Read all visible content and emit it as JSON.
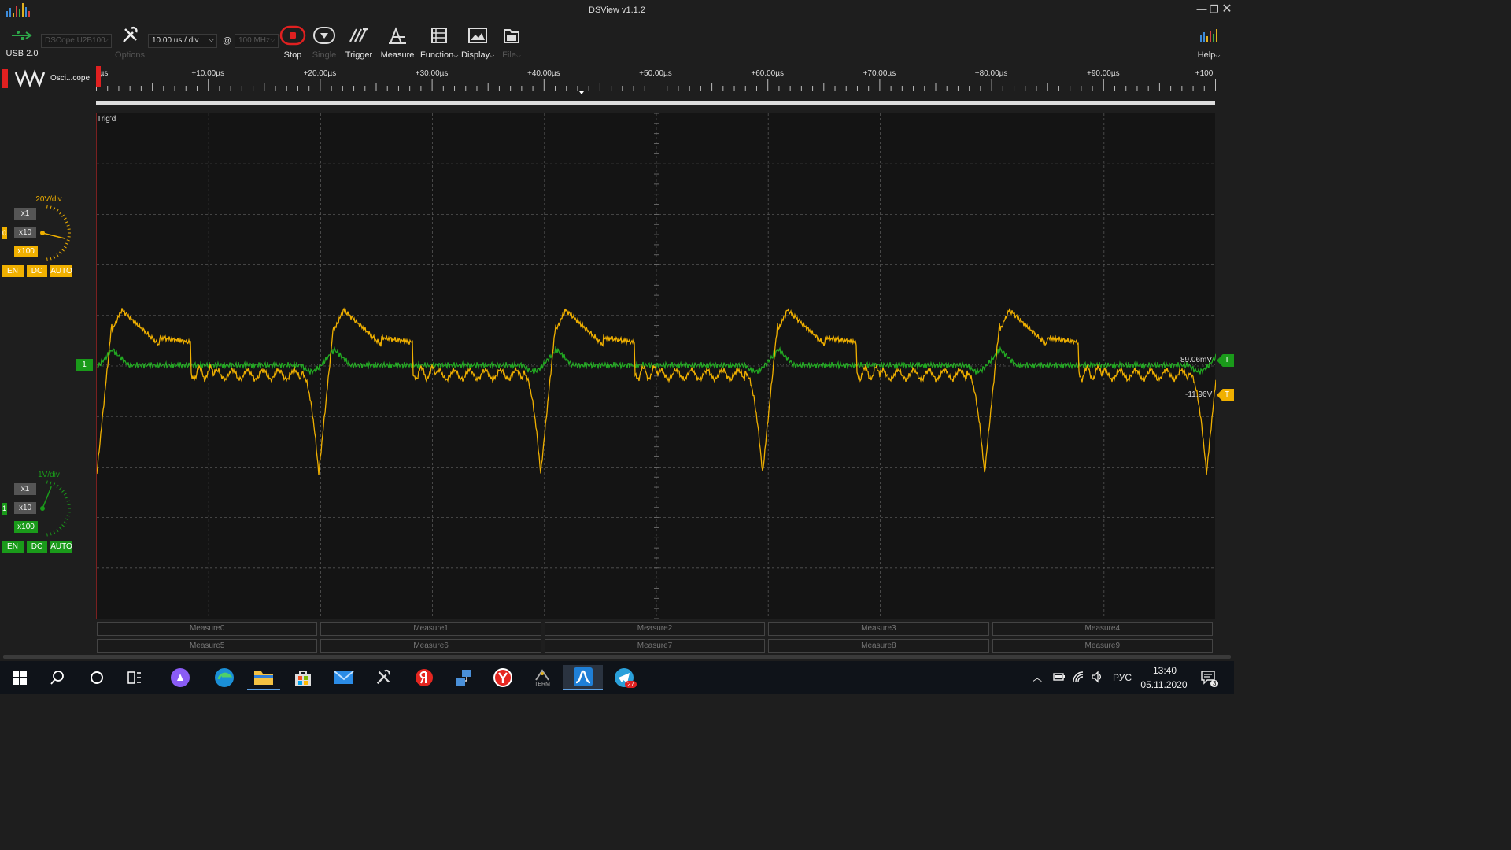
{
  "window": {
    "title": "DSView v1.1.2"
  },
  "toolbar": {
    "usb_label": "USB 2.0",
    "device_combo": "DSCope U2B100",
    "options_label": "Options",
    "timebase_combo": "10.00 us / div",
    "at_symbol": "@",
    "samplerate_combo": "100 MHz",
    "stop_label": "Stop",
    "single_label": "Single",
    "trigger_label": "Trigger",
    "measure_label": "Measure",
    "function_label": "Function",
    "display_label": "Display",
    "file_label": "File",
    "help_label": "Help"
  },
  "mode": {
    "label": "Osci...cope"
  },
  "ruler": {
    "ticks": [
      "µs",
      "+10.00µs",
      "+20.00µs",
      "+30.00µs",
      "+40.00µs",
      "+50.00µs",
      "+60.00µs",
      "+70.00µs",
      "+80.00µs",
      "+90.00µs",
      "+100"
    ]
  },
  "plot": {
    "status": "Trig'd",
    "ch1_marker": "1",
    "ch1_level": "89.06mV",
    "ch0_level": "-11.96V",
    "trigger_marker": "T"
  },
  "channels": [
    {
      "vdiv": "20V/div",
      "index": "0",
      "x1": "x1",
      "x10": "x10",
      "x100": "x100",
      "en": "EN",
      "dc": "DC",
      "auto": "AUTO",
      "color": "#f0b000"
    },
    {
      "vdiv": "1V/div",
      "index": "1",
      "x1": "x1",
      "x10": "x10",
      "x100": "x100",
      "en": "EN",
      "dc": "DC",
      "auto": "AUTO",
      "color": "#1a9a1a"
    }
  ],
  "measures": [
    "Measure0",
    "Measure1",
    "Measure2",
    "Measure3",
    "Measure4",
    "Measure5",
    "Measure6",
    "Measure7",
    "Measure8",
    "Measure9"
  ],
  "taskbar": {
    "lang": "РУС",
    "time": "13:40",
    "date": "05.11.2020",
    "telegram_badge": "27",
    "notif_count": "3",
    "term_label": "TERM"
  }
}
